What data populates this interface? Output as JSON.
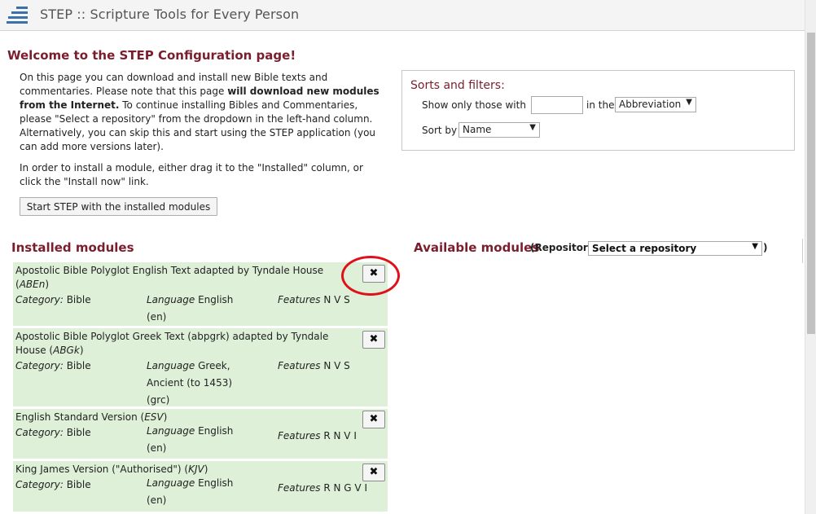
{
  "header": {
    "app_title": "STEP :: Scripture Tools for Every Person"
  },
  "welcome_title": "Welcome to the STEP Configuration page!",
  "intro": {
    "p1_a": "On this page you can download and install new Bible texts and commentaries. Please note that this page ",
    "p1_bold": "will download new modules from the Internet.",
    "p1_b": " To continue installing Bibles and Commentaries, please \"Select a repository\" from the dropdown in the left-hand column. Alternatively, you can skip this and start using the STEP application (you can add more versions later).",
    "p2": "In order to install a module, either drag it to the \"Installed\" column, or click the \"Install now\" link."
  },
  "start_button": "Start STEP with the installed modules",
  "filters": {
    "title": "Sorts and filters:",
    "show_only_label": "Show only those with",
    "show_only_value": "",
    "in_the_label": "in the",
    "field_select": "Abbreviation",
    "sort_by_label": "Sort by",
    "sort_select": "Name"
  },
  "installed": {
    "title": "Installed modules",
    "modules": [
      {
        "name": "Apostolic Bible Polyglot English Text adapted by Tyndale House",
        "abbr": "ABEn",
        "category_label": "Category:",
        "category": "Bible",
        "language_label": "Language",
        "language": "English",
        "language_code": "(en)",
        "features_label": "Features",
        "features": "N V S",
        "remove": "✖"
      },
      {
        "name": "Apostolic Bible Polyglot Greek Text (abpgrk) adapted by Tyndale House",
        "abbr": "ABGk",
        "category_label": "Category:",
        "category": "Bible",
        "language_label": "Language",
        "language": "Greek, Ancient (to 1453)",
        "language_code": "(grc)",
        "features_label": "Features",
        "features": "N V S",
        "remove": "✖"
      },
      {
        "name": "English Standard Version",
        "abbr": "ESV",
        "category_label": "Category:",
        "category": "Bible",
        "language_label": "Language",
        "language": "English",
        "language_code": "(en)",
        "features_label": "Features",
        "features": "R N V I",
        "remove": "✖"
      },
      {
        "name": "King James Version (\"Authorised\")",
        "abbr": "KJV",
        "category_label": "Category:",
        "category": "Bible",
        "language_label": "Language",
        "language": "English",
        "language_code": "(en)",
        "features_label": "Features",
        "features": "R N G V I",
        "remove": "✖"
      }
    ]
  },
  "available": {
    "title": "Available modules",
    "repo_label": "(Repository:",
    "repo_select": "Select a repository",
    "repo_close": ")"
  },
  "colors": {
    "accent": "#7a1e2e",
    "module_bg": "#def0d8",
    "highlight": "#e0101b",
    "logo": "#3d6fa8"
  }
}
